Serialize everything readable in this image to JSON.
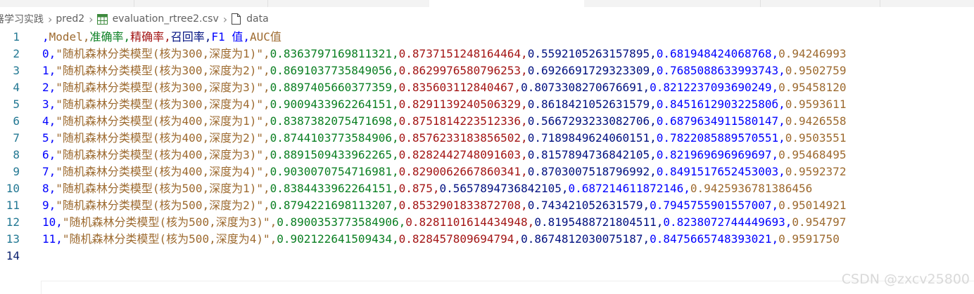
{
  "breadcrumb": {
    "folder": "器学习实践",
    "subfolder": "pred2",
    "file": "evaluation_rtree2.csv",
    "symbol": "data"
  },
  "colors": {
    "line_number": "#237893",
    "csv_columns": [
      "#0000ff",
      "#9d6a2f",
      "#0a7f22",
      "#a31515",
      "#001080"
    ]
  },
  "editor": {
    "lines": [
      {
        "number": "1",
        "fields": [
          "",
          "Model",
          "准确率",
          "精确率",
          "召回率",
          "F1 值",
          "AUC值"
        ]
      },
      {
        "number": "2",
        "fields": [
          "0",
          "\"随机森林分类模型(核为300,深度为1)\"",
          "0.8363797169811321",
          "0.8737151248164464",
          "0.5592105263157895",
          "0.681948424068768",
          "0.94246993"
        ]
      },
      {
        "number": "3",
        "fields": [
          "1",
          "\"随机森林分类模型(核为300,深度为2)\"",
          "0.8691037735849056",
          "0.8629976580796253",
          "0.6926691729323309",
          "0.7685088633993743",
          "0.9502759"
        ]
      },
      {
        "number": "4",
        "fields": [
          "2",
          "\"随机森林分类模型(核为300,深度为3)\"",
          "0.8897405660377359",
          "0.835603112840467",
          "0.8073308270676691",
          "0.8212237093690249",
          "0.95458120"
        ]
      },
      {
        "number": "5",
        "fields": [
          "3",
          "\"随机森林分类模型(核为300,深度为4)\"",
          "0.9009433962264151",
          "0.8291139240506329",
          "0.8618421052631579",
          "0.845161290322580б",
          "0.9593611"
        ]
      },
      {
        "number": "6",
        "fields": [
          "4",
          "\"随机森林分类模型(核为400,深度为1)\"",
          "0.8387382075471698",
          "0.8751814223512336",
          "0.5667293233082706",
          "0.6879634911580147",
          "0.9426558"
        ]
      },
      {
        "number": "7",
        "fields": [
          "5",
          "\"随机森林分类模型(核为400,深度为2)\"",
          "0.8744103773584906",
          "0.8576233183856502",
          "0.7189849624060151",
          "0.7822085889570551",
          "0.9503551"
        ]
      },
      {
        "number": "8",
        "fields": [
          "6",
          "\"随机森林分类模型(核为400,深度为3)\"",
          "0.8891509433962265",
          "0.8282442748091603",
          "0.8157894736842105",
          "0.821969696969697",
          "0.95468495"
        ]
      },
      {
        "number": "9",
        "fields": [
          "7",
          "\"随机森林分类模型(核为400,深度为4)\"",
          "0.9030070754716981",
          "0.8290062667860341",
          "0.8703007518796992",
          "0.8491517652453003",
          "0.9592372"
        ]
      },
      {
        "number": "10",
        "fields": [
          "8",
          "\"随机森林分类模型(核为500,深度为1)\"",
          "0.8384433962264151",
          "0.875",
          "0.5657894736842105",
          "0.687214611872146",
          "0.9425936781386456"
        ]
      },
      {
        "number": "11",
        "fields": [
          "9",
          "\"随机森林分类模型(核为500,深度为2)\"",
          "0.8794221698113207",
          "0.8532901833872708",
          "0.74342105263157​9",
          "0.7945755901557007",
          "0.95014921"
        ]
      },
      {
        "number": "12",
        "fields": [
          "10",
          "\"随机森林分类模型(核为500,深度为3)\"",
          "0.8900353773584906",
          "0.8281101614434948",
          "0.8195488721804511",
          "0.8238072744449693",
          "0.954797"
        ]
      },
      {
        "number": "13",
        "fields": [
          "11",
          "\"随机森林分类模型(核为500,深度为4)\"",
          "0.90212264150943​4",
          "0.8284578096947​94",
          "0.8674812030075187",
          "0.8475665748393021",
          "0.9591750"
        ]
      },
      {
        "number": "14",
        "fields": []
      }
    ]
  },
  "watermark": "CSDN @zxcv25800"
}
